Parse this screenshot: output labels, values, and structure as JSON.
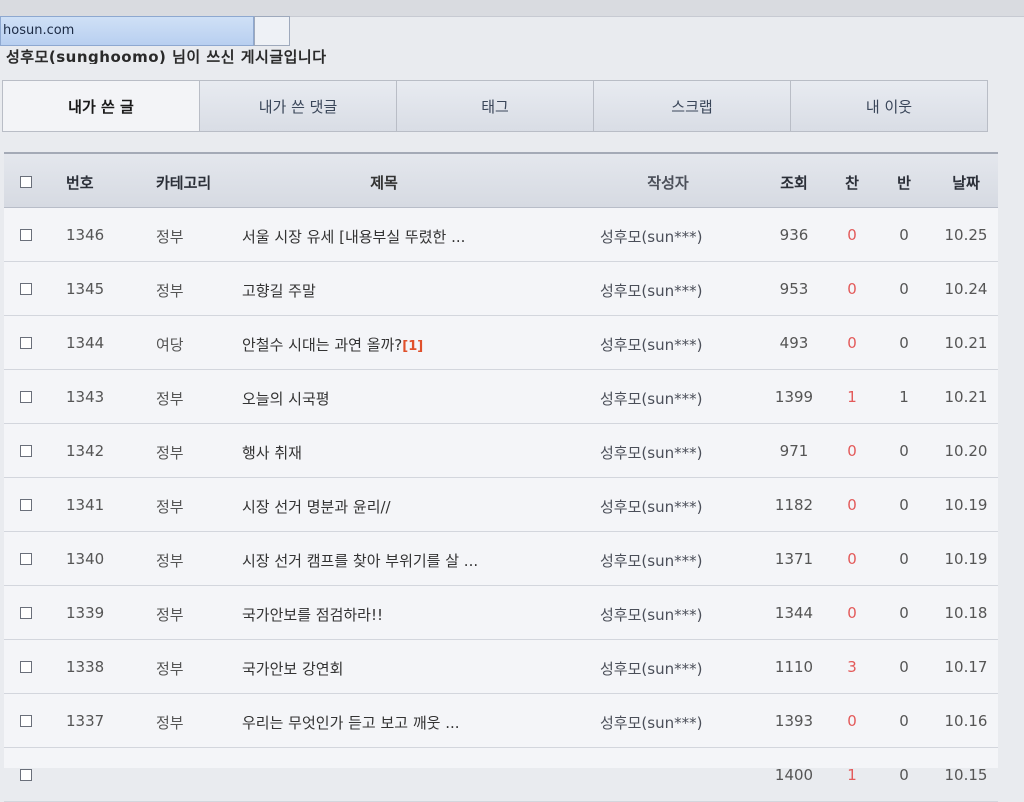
{
  "browser": {
    "url_tab": "hosun.com"
  },
  "headline": "성후모(sunghoomo) 님이 쓰신 게시글입니다",
  "tabs": [
    {
      "label": "내가 쓴 글"
    },
    {
      "label": "내가 쓴 댓글"
    },
    {
      "label": "태그"
    },
    {
      "label": "스크랩"
    },
    {
      "label": "내 이웃"
    }
  ],
  "columns": {
    "no": "번호",
    "category": "카테고리",
    "title": "제목",
    "author": "작성자",
    "views": "조회",
    "up": "찬",
    "down": "반",
    "date": "날짜"
  },
  "rows": [
    {
      "no": "1346",
      "category": "정부",
      "title": "서울 시장 유세 [내용부실 뚜렸한 ...",
      "comments": "",
      "author": "성후모(sun***)",
      "views": "936",
      "up": "0",
      "down": "0",
      "date": "10.25"
    },
    {
      "no": "1345",
      "category": "정부",
      "title": "고향길 주말",
      "comments": "",
      "author": "성후모(sun***)",
      "views": "953",
      "up": "0",
      "down": "0",
      "date": "10.24"
    },
    {
      "no": "1344",
      "category": "여당",
      "title": "안철수 시대는 과연 올까?",
      "comments": "[1]",
      "author": "성후모(sun***)",
      "views": "493",
      "up": "0",
      "down": "0",
      "date": "10.21"
    },
    {
      "no": "1343",
      "category": "정부",
      "title": "오늘의 시국평",
      "comments": "",
      "author": "성후모(sun***)",
      "views": "1399",
      "up": "1",
      "down": "1",
      "date": "10.21"
    },
    {
      "no": "1342",
      "category": "정부",
      "title": "행사 취재",
      "comments": "",
      "author": "성후모(sun***)",
      "views": "971",
      "up": "0",
      "down": "0",
      "date": "10.20"
    },
    {
      "no": "1341",
      "category": "정부",
      "title": "시장 선거 명분과 윤리//",
      "comments": "",
      "author": "성후모(sun***)",
      "views": "1182",
      "up": "0",
      "down": "0",
      "date": "10.19"
    },
    {
      "no": "1340",
      "category": "정부",
      "title": "시장 선거 캠프를 찾아 부위기를 살 ...",
      "comments": "",
      "author": "성후모(sun***)",
      "views": "1371",
      "up": "0",
      "down": "0",
      "date": "10.19"
    },
    {
      "no": "1339",
      "category": "정부",
      "title": "국가안보를 점검하라!!",
      "comments": "",
      "author": "성후모(sun***)",
      "views": "1344",
      "up": "0",
      "down": "0",
      "date": "10.18"
    },
    {
      "no": "1338",
      "category": "정부",
      "title": "국가안보 강연회",
      "comments": "",
      "author": "성후모(sun***)",
      "views": "1110",
      "up": "3",
      "down": "0",
      "date": "10.17"
    },
    {
      "no": "1337",
      "category": "정부",
      "title": "우리는 무엇인가 듣고 보고 깨웃 ...",
      "comments": "",
      "author": "성후모(sun***)",
      "views": "1393",
      "up": "0",
      "down": "0",
      "date": "10.16"
    },
    {
      "no": "",
      "category": "",
      "title": "",
      "comments": "",
      "author": "",
      "views": "1400",
      "up": "1",
      "down": "0",
      "date": "10.15"
    }
  ],
  "colors": {
    "accent_red": "#e35a5a",
    "comment_count": "#e0502b",
    "header_bg": "#d6dae2"
  }
}
